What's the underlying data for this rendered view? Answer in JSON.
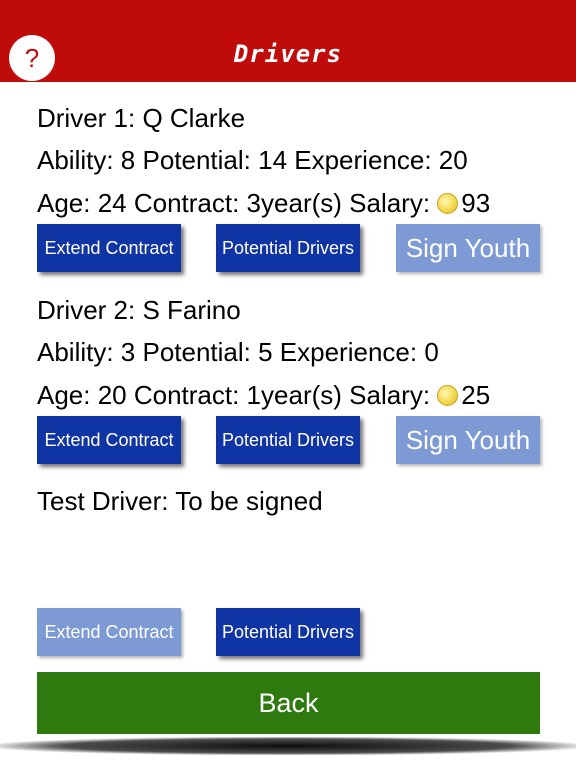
{
  "header": {
    "title": "Drivers",
    "help_label": "?",
    "background_color": "#c00b0b"
  },
  "driver1": {
    "name_line": "Driver 1: Q Clarke",
    "stats_line": "Ability: 8 Potential: 14 Experience: 20",
    "contract_line_prefix": "Age: 24 Contract: 3year(s) Salary: ",
    "salary": "93",
    "buttons": {
      "extend": "Extend Contract",
      "potential": "Potential Drivers",
      "sign_youth": "Sign Youth"
    }
  },
  "driver2": {
    "name_line": "Driver 2: S Farino",
    "stats_line": "Ability: 3 Potential: 5 Experience: 0",
    "contract_line_prefix": "Age: 20 Contract: 1year(s) Salary: ",
    "salary": "25",
    "buttons": {
      "extend": "Extend Contract",
      "potential": "Potential Drivers",
      "sign_youth": "Sign Youth"
    }
  },
  "test_driver": {
    "line": "Test Driver: To be signed",
    "buttons": {
      "extend": "Extend Contract",
      "potential": "Potential Drivers"
    }
  },
  "back_label": "Back",
  "colors": {
    "button_dark": "#0f34a3",
    "button_light": "#7d9ad4",
    "back_button": "#2f7a0f"
  },
  "icons": {
    "salary_coin": "coin-icon",
    "help": "question-mark-icon"
  }
}
